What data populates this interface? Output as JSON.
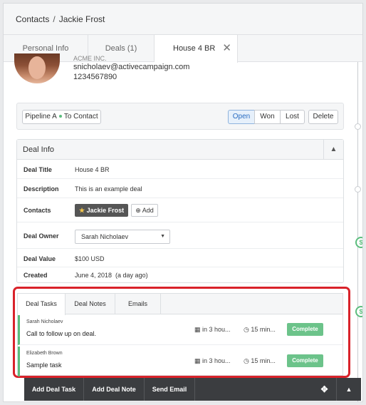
{
  "breadcrumb": {
    "root": "Contacts",
    "separator": "/",
    "current": "Jackie Frost"
  },
  "tabs": [
    {
      "label": "Personal Info"
    },
    {
      "label": "Deals (1)"
    },
    {
      "label": "House 4 BR",
      "close": "✕"
    }
  ],
  "contact": {
    "company": "ACME INC.",
    "email": "snicholaev@activecampaign.com",
    "phone": "1234567890"
  },
  "pipeline": {
    "label_a": "Pipeline A",
    "label_b": "To Contact",
    "status_buttons": [
      "Open",
      "Won",
      "Lost"
    ],
    "delete_label": "Delete"
  },
  "deal_info": {
    "heading": "Deal Info",
    "rows": [
      {
        "label": "Deal Title",
        "value": "House 4 BR"
      },
      {
        "label": "Description",
        "value": "This is an example deal"
      },
      {
        "label": "Contacts",
        "chip": "Jackie Frost",
        "add_label": "Add"
      },
      {
        "label": "Deal Owner",
        "select": "Sarah Nicholaev"
      },
      {
        "label": "Deal Value",
        "value": "$100 USD"
      },
      {
        "label": "Created",
        "value": "June 4, 2018  (a day ago)"
      }
    ]
  },
  "task_panel": {
    "tabs": [
      "Deal Tasks",
      "Deal Notes",
      "Emails"
    ],
    "tasks": [
      {
        "owner": "Sarah Nicholaev",
        "title": "Call to follow up on deal.",
        "due": "in 3 hou...",
        "duration": "15 min...",
        "action": "Complete"
      },
      {
        "owner": "Elizabeth Brown",
        "title": "Sample task",
        "due": "in 3 hou...",
        "duration": "15 min...",
        "action": "Complete"
      }
    ]
  },
  "bottom_bar": {
    "add_task": "Add Deal Task",
    "add_note": "Add Deal Note",
    "send_email": "Send Email"
  },
  "colors": {
    "accent_green": "#5bbd7d",
    "highlight_red": "#d9222a",
    "open_blue": "#2a6cc2"
  }
}
